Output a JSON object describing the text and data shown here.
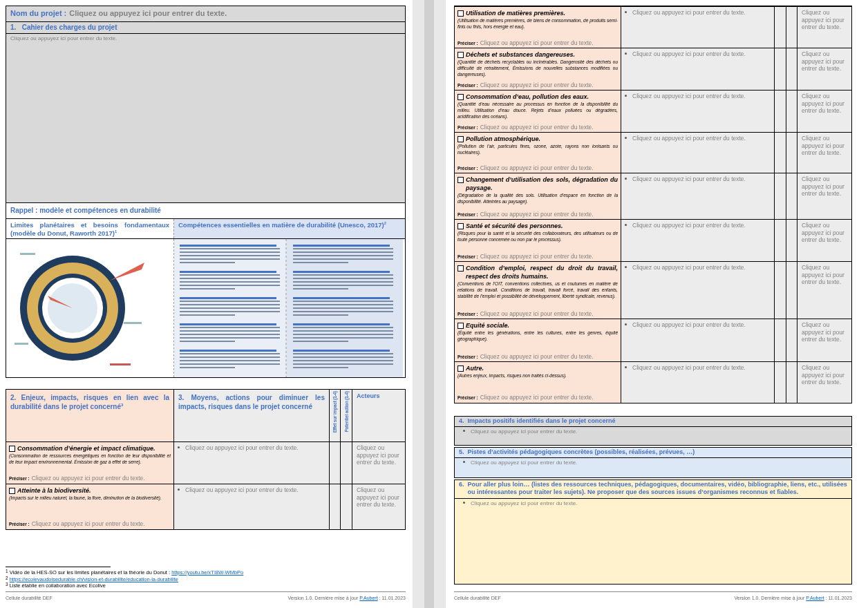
{
  "project": {
    "label": "Nom du projet :",
    "placeholder": "Cliquez ou appuyez ici pour entrer du texte."
  },
  "specifications": {
    "number": "1.",
    "title": "Cahier des charges du projet",
    "placeholder": "Cliquez ou appuyez ici pour entrer du texte."
  },
  "reminder": {
    "title": "Rappel : modèle et compétences en durabilité",
    "columns": [
      {
        "title": "Limites planétaires et besoins fondamentaux (modèle du Donut, Raworth 2017)$^{1}$",
        "kind": "donut"
      },
      {
        "title": "Compétences essentielles en matière de durabilité (Unesco, 2017)$^{2}$",
        "kind": "competences"
      }
    ]
  },
  "issues_table": {
    "columns": [
      {
        "number": "2.",
        "title": "Enjeux, impacts, risques en lien avec la durabilité dans le projet concerné$^{3}$",
        "kind": "wide"
      },
      {
        "number": "3.",
        "title": "Moyens, actions pour diminuer les impacts, risques dans le projet concerné",
        "kind": "wide"
      },
      {
        "title": "Effet sur impact (1-4)",
        "kind": "vertical"
      },
      {
        "title": "Potentiel action (1-4)",
        "kind": "vertical"
      },
      {
        "title": "Acteurs",
        "kind": "plain"
      }
    ],
    "rows": [
      {
        "checked": false,
        "title": "Consommation d’énergie et impact climatique.",
        "description": "(Consommation de ressources énergétiques en fonction de leur disponibilité et de leur impact environnemental. Émission de gaz à effet de serre).",
        "specify_label": "Préciser :",
        "specify_placeholder": "Cliquez ou appuyez ici pour entrer du texte.",
        "measures_placeholder": "Cliquez ou appuyez ici pour entrer du texte.",
        "actors_placeholder": "Cliquez ou appuyez ici pour entrer du texte."
      },
      {
        "checked": false,
        "title": "Atteinte à la biodiversité.",
        "description": "(Impacts sur le milieu naturel, la faune, la flore, diminution de la biodiversité).",
        "specify_label": "Préciser :",
        "specify_placeholder": "Cliquez ou appuyez ici pour entrer du texte.",
        "measures_placeholder": "Cliquez ou appuyez ici pour entrer du texte.",
        "actors_placeholder": "Cliquez ou appuyez ici pour entrer du texte."
      }
    ]
  },
  "footnotes": [
    {
      "mark": "1",
      "text": "Vidéo de la HES-SO sur les limites planétaires et la théorie du Donut : ",
      "link": "https://youtu.be/xTI8W-WMbPo"
    },
    {
      "mark": "2",
      "link": "https://ecolevaudoisedurable.ch/vision-et-durabilite/education-la-durabilite"
    },
    {
      "mark": "3",
      "text": "Liste établie en collaboration avec Ecolive"
    }
  ],
  "footer_left_page": {
    "left": "Cellule durabilité DEF",
    "version": "Version 1.0. Dernière mise à jour ",
    "author": "P.Aubert",
    "date": " : 11.01.2023"
  },
  "issues_table_continued": {
    "rows": [
      {
        "checked": false,
        "title": "Utilisation de matières premières.",
        "description": "(Utilisation de matières premières, de biens de consommation, de produits semi-finis ou finis, hors énergie et eau).",
        "specify_label": "Préciser :",
        "specify_placeholder": "Cliquez ou appuyez ici pour entrer du texte.",
        "measures_placeholder": "Cliquez ou appuyez ici pour entrer du texte.",
        "actors_placeholder": "Cliquez ou appuyez ici pour entrer du texte."
      },
      {
        "checked": false,
        "title": "Déchets et substances dangereuses.",
        "description": "(Quantité de déchets recyclables ou incinérables. Dangerosité des déchets ou difficulté de retraitement, Émissions de nouvelles substances modifiées ou dangereuses).",
        "specify_label": "Préciser :",
        "specify_placeholder": "Cliquez ou appuyez ici pour entrer du texte.",
        "measures_placeholder": "Cliquez ou appuyez ici pour entrer du texte.",
        "actors_placeholder": "Cliquez ou appuyez ici pour entrer du texte."
      },
      {
        "checked": false,
        "title": "Consommation d’eau, pollution des eaux.",
        "description": "(Quantité d’eau nécessaire au processus en fonction de la disponibilité du milieu. Utilisation d’eau douce. Rejets d’eaux polluées ou dégradées, acidification des océans).",
        "specify_label": "Préciser :",
        "specify_placeholder": "Cliquez ou appuyez ici pour entrer du texte.",
        "measures_placeholder": "Cliquez ou appuyez ici pour entrer du texte.",
        "actors_placeholder": "Cliquez ou appuyez ici pour entrer du texte."
      },
      {
        "checked": false,
        "title": "Pollution atmosphérique.",
        "description": "(Pollution de l’air, particules fines, ozone, azote, rayons non ionisants ou nucléaires).",
        "specify_label": "Préciser :",
        "specify_placeholder": "Cliquez ou appuyez ici pour entrer du texte.",
        "measures_placeholder": "Cliquez ou appuyez ici pour entrer du texte.",
        "actors_placeholder": "Cliquez ou appuyez ici pour entrer du texte."
      },
      {
        "checked": false,
        "title": "Changement d’utilisation des sols, dégradation du paysage.",
        "description": "(Dégradation de la qualité des sols. Utilisation d’espace en fonction de la disponibilité. Atteintes au paysage).",
        "specify_label": "Préciser :",
        "specify_placeholder": "Cliquez ou appuyez ici pour entrer du texte.",
        "measures_placeholder": "Cliquez ou appuyez ici pour entrer du texte.",
        "actors_placeholder": "Cliquez ou appuyez ici pour entrer du texte."
      },
      {
        "checked": false,
        "title": "Santé et sécurité des personnes.",
        "description": "(Risques pour la santé et la sécurité des collaborateurs, des utilisateurs ou de toute personne concernée ou non par le processus).",
        "specify_label": "Préciser :",
        "specify_placeholder": "Cliquez ou appuyez ici pour entrer du texte.",
        "measures_placeholder": "Cliquez ou appuyez ici pour entrer du texte.",
        "actors_placeholder": "Cliquez ou appuyez ici pour entrer du texte."
      },
      {
        "checked": false,
        "title": "Condition d’emploi, respect du droit du travail, respect des droits humains.",
        "description": "(Conventions de l’OIT, conventions collectives, us et coutumes en matière de relations de travail. Conditions de travail, travail forcé, travail des enfants, stabilité de l’emploi et possibilité de développement, liberté syndicale, revenus).",
        "specify_label": "Préciser :",
        "specify_placeholder": "Cliquez ou appuyez ici pour entrer du texte.",
        "measures_placeholder": "Cliquez ou appuyez ici pour entrer du texte.",
        "actors_placeholder": "Cliquez ou appuyez ici pour entrer du texte."
      },
      {
        "checked": false,
        "title": "Equité sociale.",
        "description": "(Équité entre les générations, entre les cultures, entre les genres, équité géographique).",
        "specify_label": "Préciser :",
        "specify_placeholder": "Cliquez ou appuyez ici pour entrer du texte.",
        "measures_placeholder": "Cliquez ou appuyez ici pour entrer du texte.",
        "actors_placeholder": "Cliquez ou appuyez ici pour entrer du texte."
      },
      {
        "checked": false,
        "title": "Autre.",
        "description": "(Autres enjeux, impacts, risques non traités ci-dessus).",
        "specify_label": "Préciser :",
        "specify_placeholder": "Cliquez ou appuyez ici pour entrer du texte.",
        "measures_placeholder": "Cliquez ou appuyez ici pour entrer du texte.",
        "actors_placeholder": "Cliquez ou appuyez ici pour entrer du texte."
      }
    ]
  },
  "sections": [
    {
      "number": "4.",
      "title": "Impacts positifs identifiés dans le projet concerné",
      "placeholder": "Cliquez ou appuyez ici pour entrer du texte.",
      "color": "#d9d9d9"
    },
    {
      "number": "5.",
      "title": "Pistes d’activités pédagogiques concrètes (possibles, réalisées, prévues, …)",
      "placeholder": "Cliquez ou appuyez ici pour entrer du texte.",
      "color": "#dde8f6"
    },
    {
      "number": "6.",
      "title": "Pour aller plus loin… (listes des ressources techniques, pédagogiques, documentaires, vidéo, bibliographie, liens, etc., utilisées ou intéressantes pour traiter les sujets). Ne proposer que des sources issues d’organismes reconnus et fiables.",
      "placeholder": "Cliquez ou appuyez ici pour entrer du texte.",
      "color": "#fff2cc"
    }
  ],
  "footer_right_page": {
    "left": "Cellule durabilité DEF",
    "version": "Version 1.0. Dernière mise à jour ",
    "author": "P.Aubert",
    "date": " : 11.01.2023"
  }
}
